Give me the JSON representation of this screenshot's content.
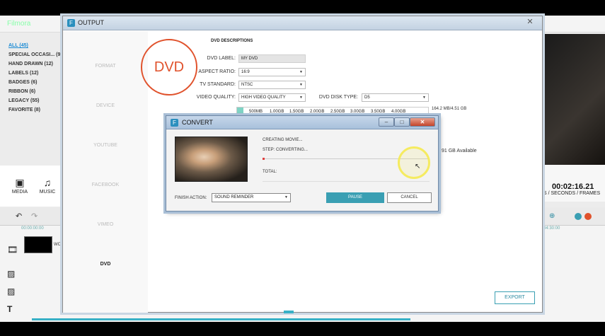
{
  "app": {
    "logo": "Filmora",
    "categories": [
      {
        "label": "ALL (45)"
      },
      {
        "label": "SPECIAL OCCASI... (9)"
      },
      {
        "label": "HAND DRAWN (12)"
      },
      {
        "label": "LABELS (12)"
      },
      {
        "label": "BADGES (6)"
      },
      {
        "label": "RIBBON (6)"
      },
      {
        "label": "LEGACY (55)"
      },
      {
        "label": "FAVORITE (8)"
      }
    ],
    "media_bar": {
      "media": "MEDIA",
      "music": "MUSIC"
    },
    "timecode": "00:02:16.21",
    "timecode_units": "S / SECONDS / FRAMES",
    "timeline_start": "00:00:00:00",
    "timeline_end": "04:30:00",
    "clip_label": "WO"
  },
  "output": {
    "title": "OUTPUT",
    "sidebar": [
      "FORMAT",
      "DEVICE",
      "YOUTUBE",
      "FACEBOOK",
      "VIMEO",
      "DVD"
    ],
    "active_tab": "DVD",
    "dvd_logo": "DVD",
    "section_title": "DVD DESCRIPTIONS",
    "fields": {
      "label_label": "DVD LABEL:",
      "label_value": "MY DVD",
      "aspect_label": "ASPECT RATIO:",
      "aspect_value": "16:9",
      "tv_label": "TV STANDARD:",
      "tv_value": "NTSC",
      "quality_label": "VIDEO QUALITY:",
      "quality_value": "HIGH VIDEO QUALITY",
      "disk_label": "DVD DISK TYPE:",
      "disk_value": "D5"
    },
    "capacity_ticks": [
      "500MB",
      "1.00GB",
      "1.50GB",
      "2.00GB",
      "2.50GB",
      "3.00GB",
      "3.50GB",
      "4.00GB"
    ],
    "capacity_summary": "164.2 MB/4.51 GB",
    "available": "91 GB Available",
    "export": "EXPORT"
  },
  "convert": {
    "title": "CONVERT",
    "creating": "CREATING MOVIE...",
    "step": "STEP: CONVERTING...",
    "total": "TOTAL:",
    "progress": 0.01,
    "finish_label": "FINISH ACTION:",
    "finish_value": "SOUND REMINDER",
    "pause": "PAUSE",
    "cancel": "CANCEL",
    "accent": "#3a9fb3"
  }
}
